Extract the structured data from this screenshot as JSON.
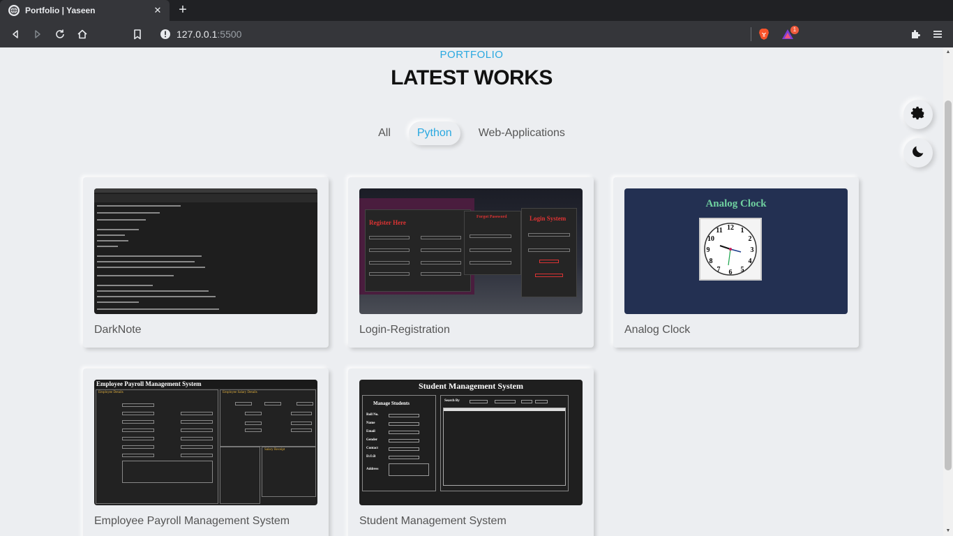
{
  "browser": {
    "tab_title": "Portfolio | Yaseen",
    "tab_close": "✕",
    "new_tab": "+",
    "url_host": "127.0.0.1",
    "url_port": ":5500",
    "extension_badge": "1"
  },
  "page": {
    "kicker": "PORTFOLIO",
    "heading": "LATEST WORKS",
    "filters": [
      {
        "label": "All",
        "active": false
      },
      {
        "label": "Python",
        "active": true
      },
      {
        "label": "Web-Applications",
        "active": false
      }
    ],
    "cards": [
      {
        "title": "DarkNote"
      },
      {
        "title": "Login-Registration"
      },
      {
        "title": "Analog Clock"
      },
      {
        "title": "Employee Payroll Management System"
      },
      {
        "title": "Student Management System"
      }
    ],
    "thumbnails": {
      "login_register": "Register Here",
      "login_forget": "Forgot Password",
      "login_system": "Login System",
      "clock_title": "Analog Clock",
      "payroll_title": "Employee Payroll Management System",
      "payroll_details": "Employee Details",
      "payroll_salary": "Employee Salary Details",
      "payroll_receipt": "Salary Receipt",
      "student_title": "Student Management System",
      "student_manage": "Manage Students",
      "student_search": "Search By",
      "student_fields": [
        "Roll No.",
        "Name",
        "Email",
        "Gender",
        "Contact",
        "D.O.B",
        "Address"
      ]
    }
  },
  "colors": {
    "accent": "#29a8e0",
    "page_bg": "#eceef1",
    "chrome_dark": "#202124"
  },
  "icons": [
    "globe-icon",
    "back-icon",
    "forward-icon",
    "reload-icon",
    "home-icon",
    "bookmark-icon",
    "info-icon",
    "brave-lion-icon",
    "brave-rewards-icon",
    "extensions-icon",
    "menu-icon",
    "settings-gear-icon",
    "moon-icon"
  ]
}
